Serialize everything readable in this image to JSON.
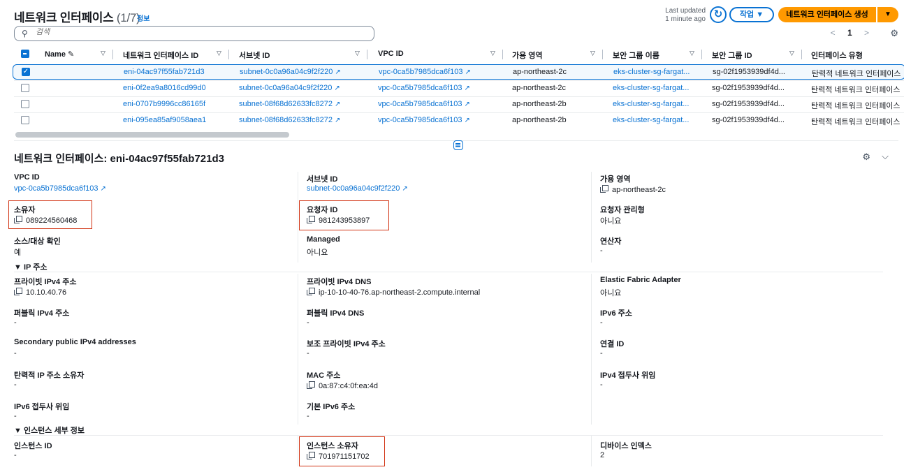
{
  "header": {
    "title": "네트워크 인터페이스",
    "count": "(1/7)",
    "info": "정보",
    "last_updated_line1": "Last updated",
    "last_updated_line2": "1 minute ago",
    "refresh_icon": "refresh-icon",
    "action_label": "작업 ▼",
    "create_label": "네트워크 인터페이스 생성",
    "create_dropdown": "▼"
  },
  "search": {
    "placeholder": "검색",
    "icon": "search-icon"
  },
  "pagination": {
    "prev": "<",
    "page": "1",
    "next": ">"
  },
  "table": {
    "columns": [
      "Name",
      "네트워크 인터페이스 ID",
      "서브넷 ID",
      "VPC ID",
      "가용 영역",
      "보안 그룹 이름",
      "보안 그룹 ID",
      "인터페이스 유형"
    ],
    "rows": [
      {
        "selected": true,
        "eni": "eni-04ac97f55fab721d3",
        "subnet": "subnet-0c0a96a04c9f2f220",
        "vpc": "vpc-0ca5b7985dca6f103",
        "az": "ap-northeast-2c",
        "sg_name": "eks-cluster-sg-fargat...",
        "sg_id": "sg-02f1953939df4d...",
        "type": "탄력적 네트워크 인터페이스"
      },
      {
        "selected": false,
        "eni": "eni-0f2ea9a8016cd99d0",
        "subnet": "subnet-0c0a96a04c9f2f220",
        "vpc": "vpc-0ca5b7985dca6f103",
        "az": "ap-northeast-2c",
        "sg_name": "eks-cluster-sg-fargat...",
        "sg_id": "sg-02f1953939df4d...",
        "type": "탄력적 네트워크 인터페이스"
      },
      {
        "selected": false,
        "eni": "eni-0707b9996cc86165f",
        "subnet": "subnet-08f68d62633fc8272",
        "vpc": "vpc-0ca5b7985dca6f103",
        "az": "ap-northeast-2b",
        "sg_name": "eks-cluster-sg-fargat...",
        "sg_id": "sg-02f1953939df4d...",
        "type": "탄력적 네트워크 인터페이스"
      },
      {
        "selected": false,
        "eni": "eni-095ea85af9058aea1",
        "subnet": "subnet-08f68d62633fc8272",
        "vpc": "vpc-0ca5b7985dca6f103",
        "az": "ap-northeast-2b",
        "sg_name": "eks-cluster-sg-fargat...",
        "sg_id": "sg-02f1953939df4d...",
        "type": "탄력적 네트워크 인터페이스"
      }
    ]
  },
  "detail": {
    "title": "네트워크 인터페이스: eni-04ac97f55fab721d3",
    "vpc_id": {
      "label": "VPC ID",
      "value": "vpc-0ca5b7985dca6f103"
    },
    "subnet_id": {
      "label": "서브넷 ID",
      "value": "subnet-0c0a96a04c9f2f220"
    },
    "az": {
      "label": "가용 영역",
      "value": "ap-northeast-2c"
    },
    "owner": {
      "label": "소유자",
      "value": "089224560468"
    },
    "requester_id": {
      "label": "요청자 ID",
      "value": "981243953897"
    },
    "requester_managed": {
      "label": "요청자 관리형",
      "value": "아니요"
    },
    "src_dst_check": {
      "label": "소스/대상 확인",
      "value": "예"
    },
    "managed": {
      "label": "Managed",
      "value": "아니요"
    },
    "operator": {
      "label": "연산자",
      "value": "-"
    },
    "ip_section": "▼ IP 주소",
    "private_ipv4": {
      "label": "프라이빗 IPv4 주소",
      "value": "10.10.40.76"
    },
    "private_ipv4_dns": {
      "label": "프라이빗 IPv4 DNS",
      "value": "ip-10-10-40-76.ap-northeast-2.compute.internal"
    },
    "efa": {
      "label": "Elastic Fabric Adapter",
      "value": "아니요"
    },
    "public_ipv4": {
      "label": "퍼블릭 IPv4 주소",
      "value": "-"
    },
    "public_ipv4_dns": {
      "label": "퍼블릭 IPv4 DNS",
      "value": "-"
    },
    "ipv6": {
      "label": "IPv6 주소",
      "value": "-"
    },
    "secondary_public": {
      "label": "Secondary public IPv4 addresses",
      "value": "-"
    },
    "secondary_private": {
      "label": "보조 프라이빗 IPv4 주소",
      "value": "-"
    },
    "association_id": {
      "label": "연결 ID",
      "value": "-"
    },
    "eip_owner": {
      "label": "탄력적 IP 주소 소유자",
      "value": "-"
    },
    "mac": {
      "label": "MAC 주소",
      "value": "0a:87:c4:0f:ea:4d"
    },
    "ipv4_prefix": {
      "label": "IPv4 접두사 위임",
      "value": "-"
    },
    "ipv6_prefix": {
      "label": "IPv6 접두사 위임",
      "value": "-"
    },
    "primary_ipv6": {
      "label": "기본 IPv6 주소",
      "value": "-"
    },
    "instance_section": "▼ 인스턴스 세부 정보",
    "instance_id": {
      "label": "인스턴스 ID",
      "value": "-"
    },
    "instance_owner": {
      "label": "인스턴스 소유자",
      "value": "701971151702"
    },
    "device_index": {
      "label": "디바이스 인덱스",
      "value": "2"
    }
  },
  "colors": {
    "accent": "#0972d3",
    "primary_button": "#ff9900",
    "highlight_box": "#d13212"
  }
}
